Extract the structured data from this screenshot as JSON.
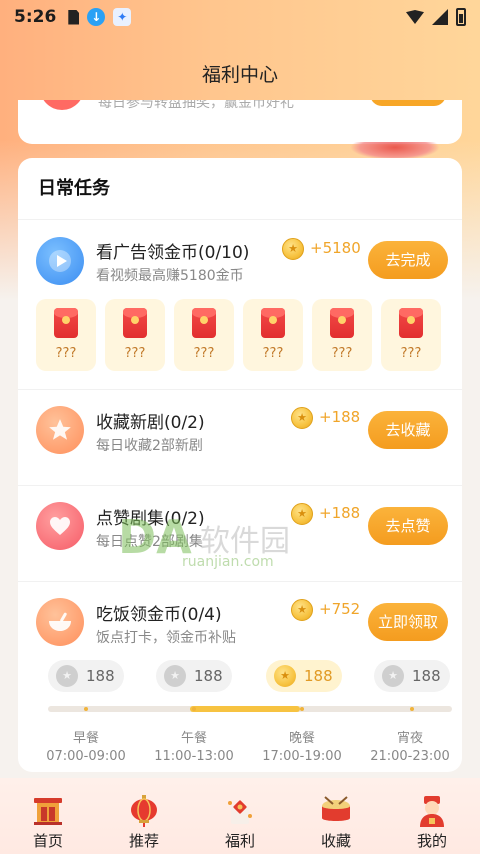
{
  "status_bar": {
    "time": "5:26"
  },
  "header": {
    "title": "福利中心"
  },
  "top_card": {
    "subtitle": "每日参与转盘抽奖，赢金币好礼"
  },
  "daily_tasks": {
    "section_title": "日常任务",
    "ad_task": {
      "title": "看广告领金币(0/10)",
      "subtitle": "看视频最高赚5180金币",
      "reward": "+5180",
      "button": "去完成",
      "packets": [
        "???",
        "???",
        "???",
        "???",
        "???",
        "???"
      ]
    },
    "collect_task": {
      "title": "收藏新剧(0/2)",
      "subtitle": "每日收藏2部新剧",
      "reward": "+188",
      "button": "去收藏"
    },
    "like_task": {
      "title": "点赞剧集(0/2)",
      "subtitle": "每日点赞2部剧集",
      "reward": "+188",
      "button": "去点赞"
    },
    "meal_task": {
      "title": "吃饭领金币(0/4)",
      "subtitle": "饭点打卡，领金币补贴",
      "reward": "+752",
      "button": "立即领取",
      "meals": [
        {
          "coins": "188",
          "name": "早餐",
          "time": "07:00-09:00"
        },
        {
          "coins": "188",
          "name": "午餐",
          "time": "11:00-13:00"
        },
        {
          "coins": "188",
          "name": "晚餐",
          "time": "17:00-19:00"
        },
        {
          "coins": "188",
          "name": "宵夜",
          "time": "21:00-23:00"
        }
      ]
    }
  },
  "watermark": {
    "logo": "DA",
    "text": "软件园",
    "url": "ruanjian.com"
  },
  "bottom_nav": [
    {
      "label": "首页",
      "icon": "home-gate-icon"
    },
    {
      "label": "推荐",
      "icon": "lantern-icon"
    },
    {
      "label": "福利",
      "icon": "fu-gift-icon"
    },
    {
      "label": "收藏",
      "icon": "drum-icon"
    },
    {
      "label": "我的",
      "icon": "fortune-god-icon"
    }
  ],
  "colors": {
    "accent_button": "#f49c1f",
    "reward_text": "#f0a52a",
    "packet_red": "#e22f2f"
  }
}
